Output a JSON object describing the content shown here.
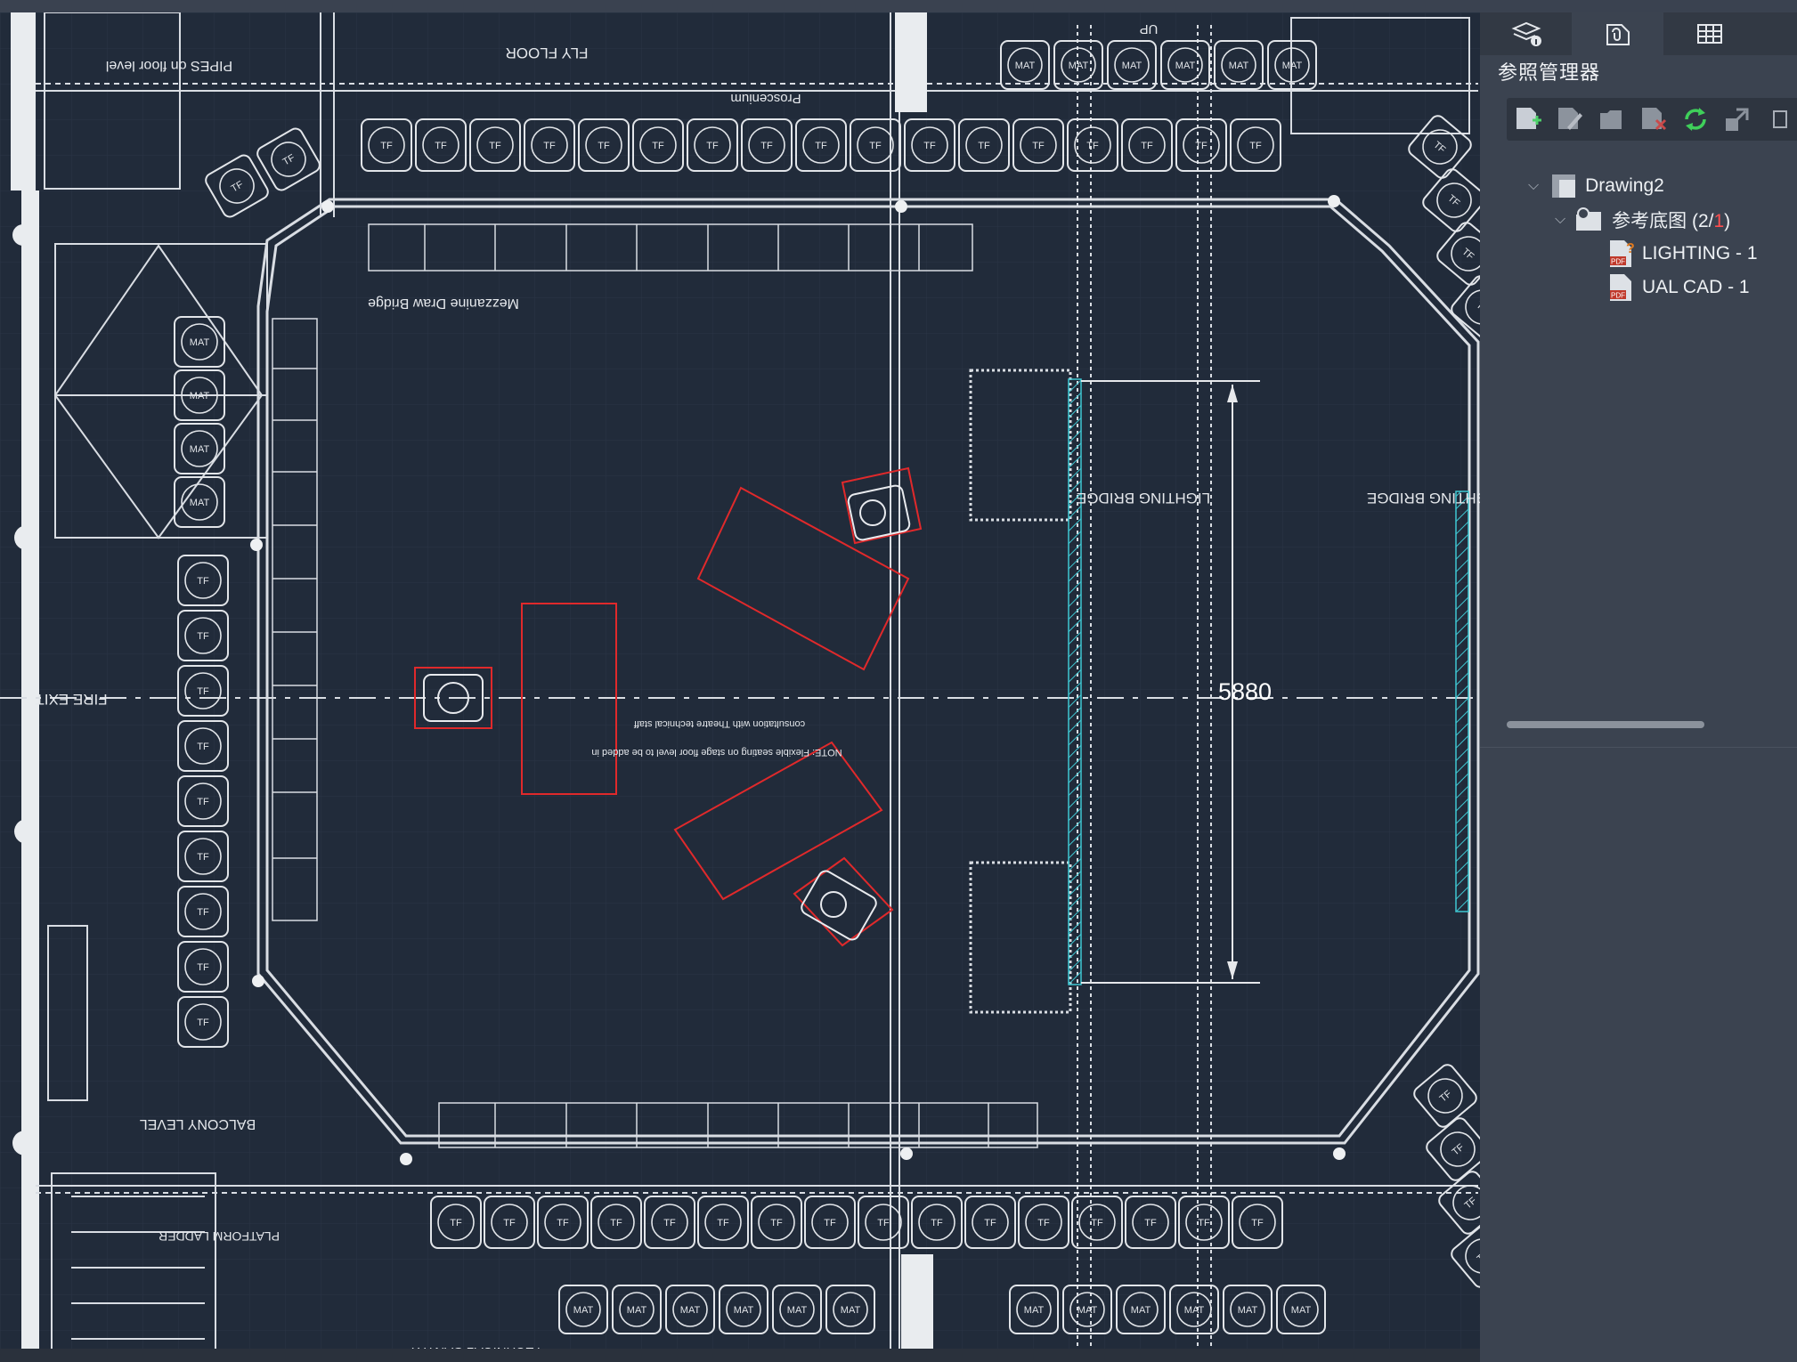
{
  "panel": {
    "title": "参照管理器",
    "tabs": [
      {
        "name": "layer-properties-icon"
      },
      {
        "name": "external-references-icon"
      },
      {
        "name": "table-icon"
      }
    ],
    "toolbar": [
      {
        "name": "attach-dwg-icon"
      },
      {
        "name": "edit-reference-icon"
      },
      {
        "name": "open-reference-icon"
      },
      {
        "name": "detach-reference-icon"
      },
      {
        "name": "reload-icon"
      },
      {
        "name": "bind-icon"
      },
      {
        "name": "more-icon"
      }
    ],
    "tree": {
      "root": "Drawing2",
      "group_label": "参考底图 (2/",
      "group_unresolved": "1",
      "group_close": ")",
      "items": [
        "LIGHTING - 1",
        "UAL CAD - 1"
      ]
    }
  },
  "drawing": {
    "dimension": "5880",
    "labels": {
      "fly_floor": "FLY FLOOR",
      "proscenium": "Proscenium",
      "pipes": "PIPES on floor level",
      "mezzanine": "Mezzanine Draw Bridge",
      "lighting_bridge": "LIGHTING BRIDGE",
      "fire_exit": "FIRE EXIT",
      "balcony": "BALCONY LEVEL",
      "ladder": "PLATFORM LADDER",
      "gantry": "TECHNICAL GANTRY",
      "note1": "NOTE: Flexible seating on stage floor level to be added in",
      "note2": "consultation with Theatre technical staff",
      "seat_tf": "TF",
      "seat_mat": "MAT",
      "up": "UP"
    }
  },
  "colors": {
    "canvas": "#212b3a",
    "lines": "#d9dde3",
    "highlight": "#e0292b",
    "hatch": "#3fc7d2",
    "panel": "#3b4350"
  }
}
